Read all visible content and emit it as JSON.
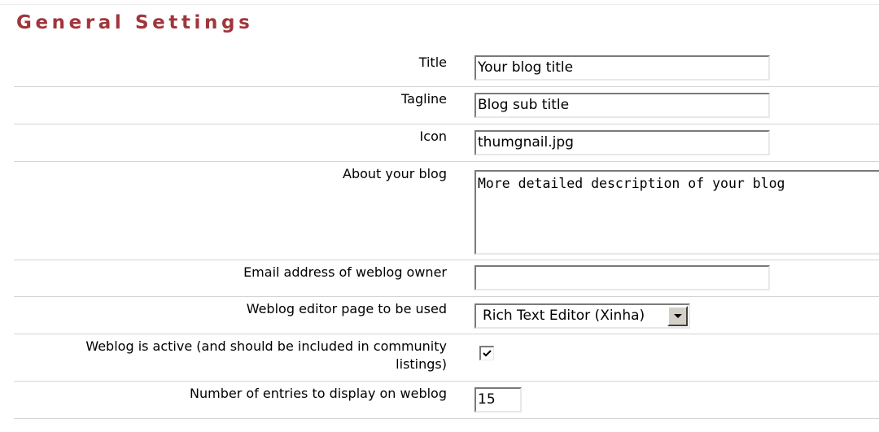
{
  "section": {
    "title": "General Settings",
    "title_color": "#a0363b"
  },
  "fields": {
    "title": {
      "label": "Title",
      "value": "Your blog title"
    },
    "tagline": {
      "label": "Tagline",
      "value": "Blog sub title"
    },
    "icon": {
      "label": "Icon",
      "value": "thumgnail.jpg"
    },
    "about": {
      "label": "About your blog",
      "value": "More detailed description of your blog"
    },
    "email": {
      "label": "Email address of weblog owner",
      "value": ""
    },
    "editor": {
      "label": "Weblog editor page to be used",
      "selected": "Rich Text Editor (Xinha)",
      "icon": "chevron-down-icon"
    },
    "active": {
      "label_line1": "Weblog is active (and should be included in community",
      "label_line2": "listings)",
      "checked": true,
      "icon": "checkmark-icon"
    },
    "entries": {
      "label": "Number of entries to display on weblog",
      "value": "15"
    }
  }
}
